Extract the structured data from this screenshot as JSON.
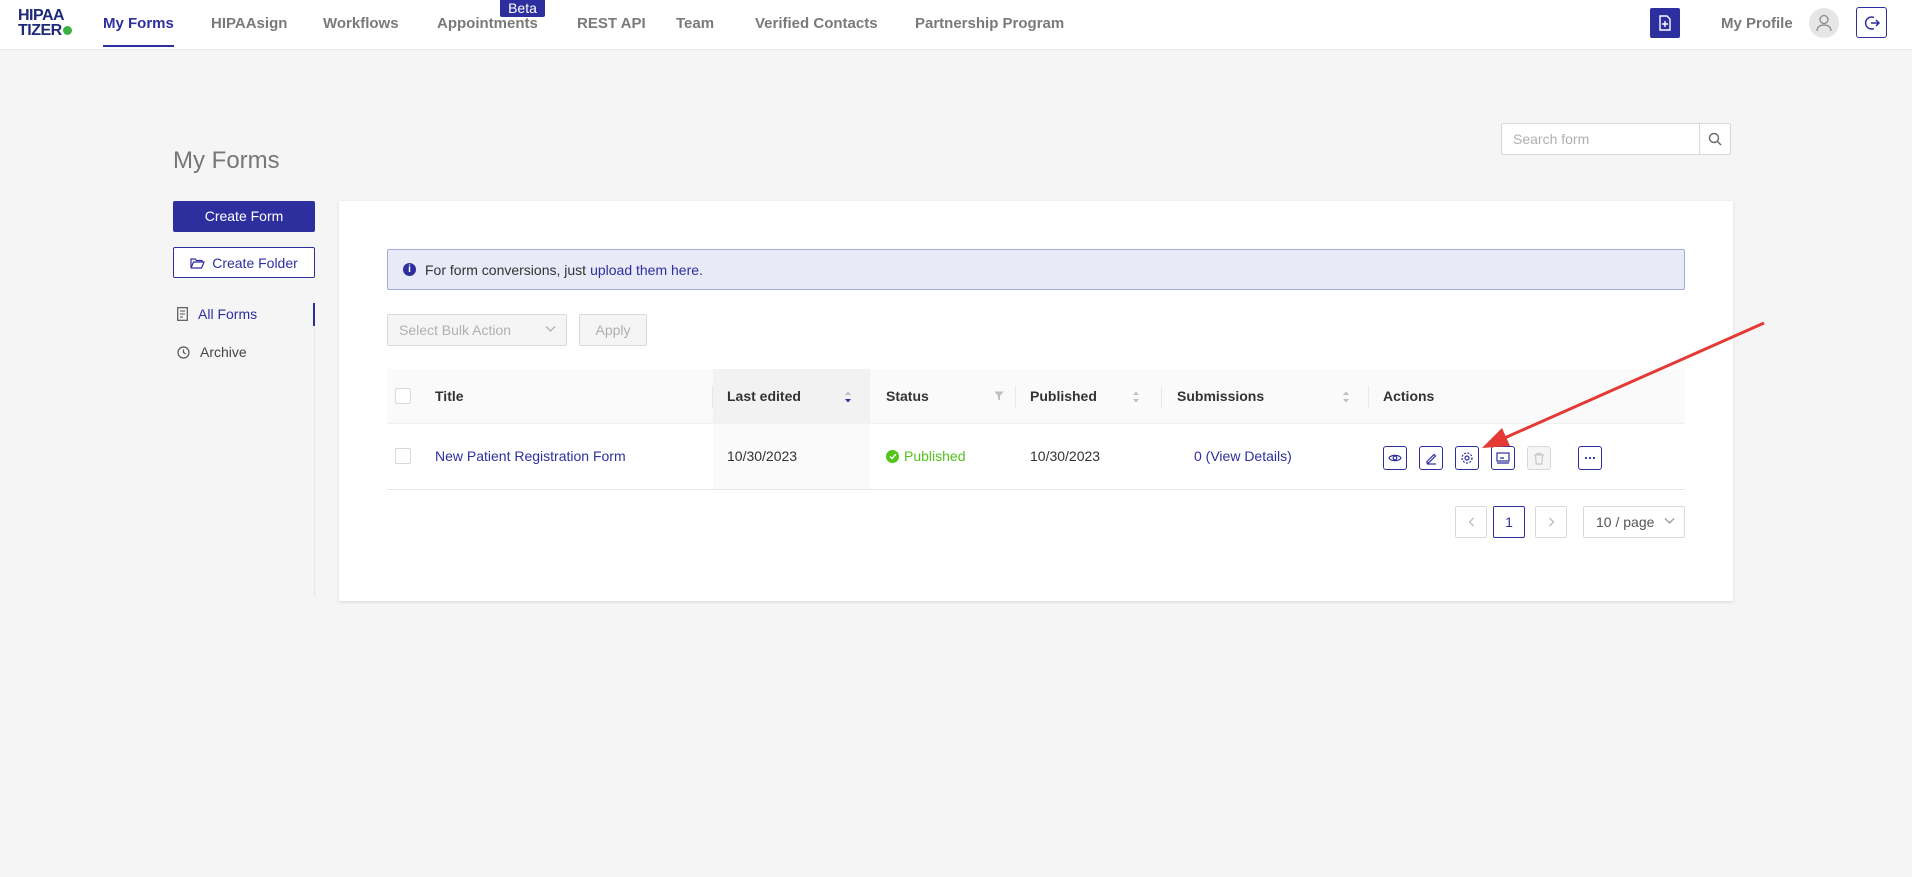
{
  "logo": {
    "line1": "HIPAA",
    "line2": "TIZER"
  },
  "nav": {
    "items": [
      "My Forms",
      "HIPAAsign",
      "Workflows",
      "Appointments",
      "REST API",
      "Team",
      "Verified Contacts",
      "Partnership Program"
    ],
    "active": "My Forms",
    "beta_label": "Beta",
    "profile_label": "My Profile"
  },
  "page": {
    "title": "My Forms",
    "search_placeholder": "Search form"
  },
  "sidebar": {
    "create_form_label": "Create Form",
    "create_folder_label": "Create Folder",
    "items": [
      {
        "label": "All Forms",
        "icon": "form-list-icon",
        "active": true
      },
      {
        "label": "Archive",
        "icon": "clock-icon",
        "active": false
      }
    ]
  },
  "info_banner": {
    "text": "For form conversions, just",
    "link": "upload them here."
  },
  "bulk": {
    "placeholder": "Select Bulk Action",
    "apply_label": "Apply"
  },
  "table": {
    "columns": [
      "Title",
      "Last edited",
      "Status",
      "Published",
      "Submissions",
      "Actions"
    ],
    "rows": [
      {
        "title": "New Patient Registration Form",
        "last_edited": "10/30/2023",
        "status": "Published",
        "published": "10/30/2023",
        "submissions": "0 (View Details)"
      }
    ]
  },
  "pagination": {
    "current_page": "1",
    "page_size": "10 / page"
  },
  "colors": {
    "brand": "#2e2f9e",
    "success": "#52c41a",
    "annotation_arrow": "#e53935"
  }
}
